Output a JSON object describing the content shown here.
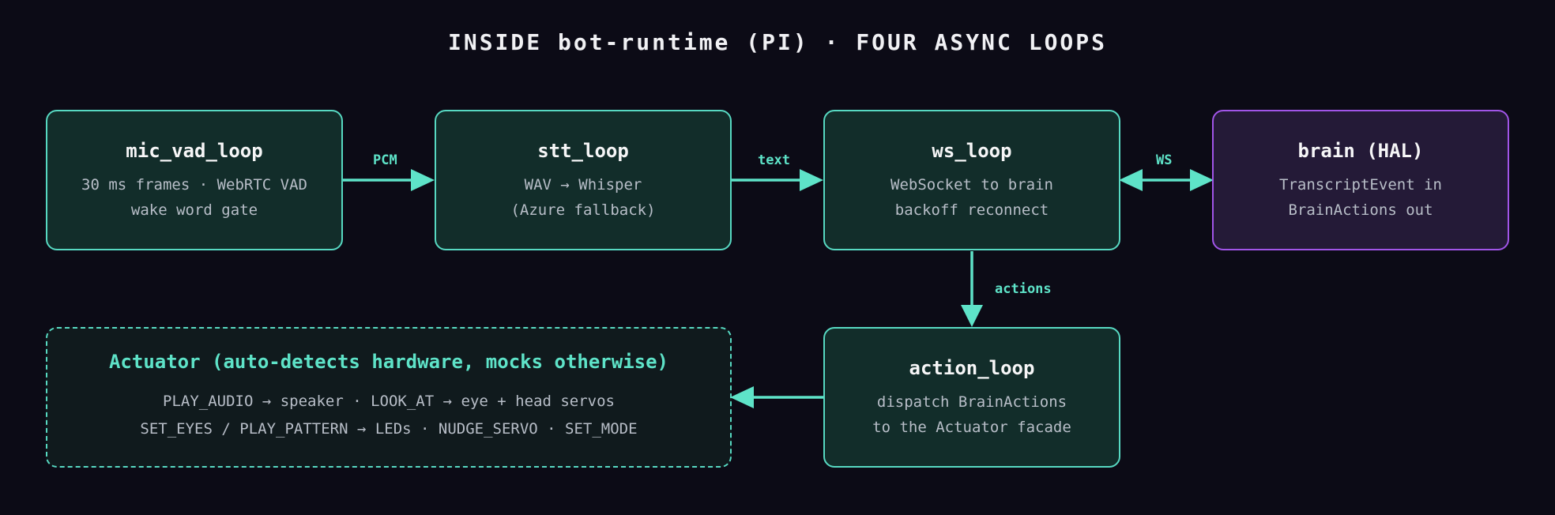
{
  "title": "INSIDE bot-runtime (PI) · FOUR ASYNC LOOPS",
  "colors": {
    "background": "#0c0b16",
    "loop_fill": "#122d2a",
    "loop_border": "#57d9c2",
    "brain_fill": "#241a37",
    "brain_border": "#a155e8",
    "arrow": "#5ee3c8"
  },
  "nodes": {
    "mic_vad_loop": {
      "title": "mic_vad_loop",
      "lines": [
        "30 ms frames · WebRTC VAD",
        "wake word gate"
      ]
    },
    "stt_loop": {
      "title": "stt_loop",
      "lines": [
        "WAV → Whisper",
        "(Azure fallback)"
      ]
    },
    "ws_loop": {
      "title": "ws_loop",
      "lines": [
        "WebSocket to brain",
        "backoff reconnect"
      ]
    },
    "brain": {
      "title": "brain (HAL)",
      "lines": [
        "TranscriptEvent in",
        "BrainActions out"
      ]
    },
    "action_loop": {
      "title": "action_loop",
      "lines": [
        "dispatch BrainActions",
        "to the Actuator facade"
      ]
    },
    "actuator": {
      "title": "Actuator (auto-detects hardware, mocks otherwise)",
      "lines": [
        "PLAY_AUDIO → speaker · LOOK_AT → eye + head servos",
        "SET_EYES / PLAY_PATTERN → LEDs · NUDGE_SERVO · SET_MODE"
      ]
    }
  },
  "edges": {
    "pcm": "PCM",
    "text": "text",
    "ws": "WS",
    "actions": "actions"
  }
}
